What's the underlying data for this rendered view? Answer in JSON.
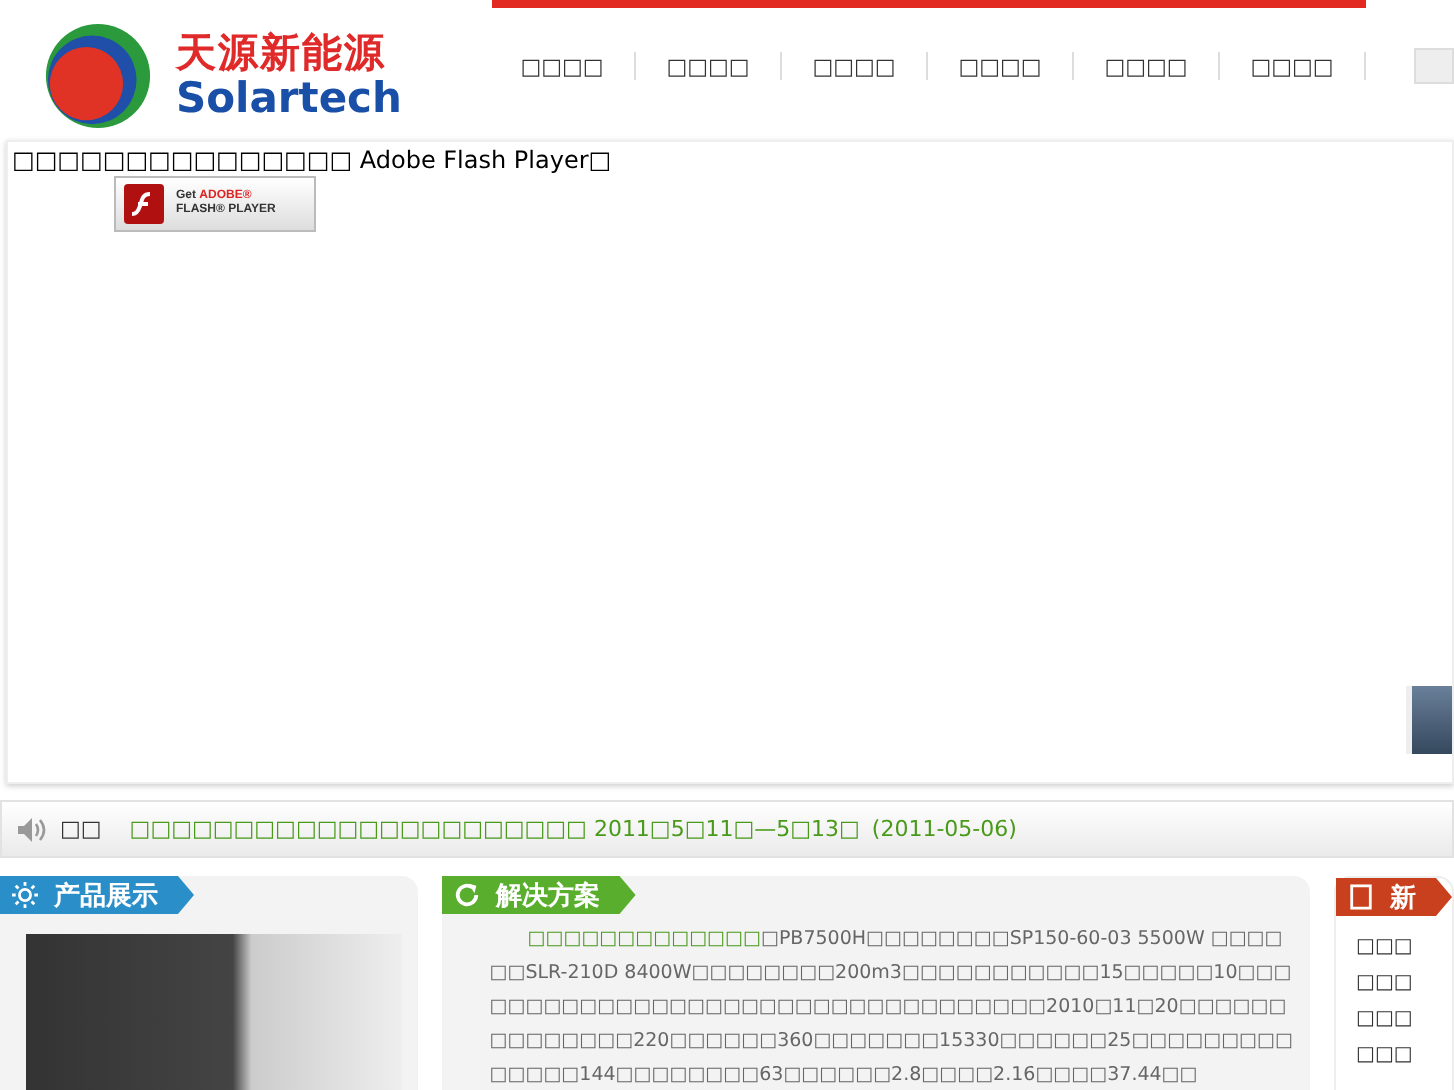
{
  "logo": {
    "cn": "天源新能源",
    "en": "Solartech"
  },
  "nav": [
    {
      "label": "□□□□"
    },
    {
      "label": "□□□□"
    },
    {
      "label": "□□□□"
    },
    {
      "label": "□□□□"
    },
    {
      "label": "□□□□"
    },
    {
      "label": "□□□□"
    }
  ],
  "flash": {
    "message": "□□□□□□□□□□□□□□□ Adobe Flash Player□",
    "badge_top": "Get",
    "badge_brand": "ADOBE®",
    "badge_bottom": "FLASH® PLAYER"
  },
  "notice": {
    "label": "□□",
    "link": "□□□□□□□□□□□□□□□□□□□□□□ 2011□5□11□—5□13□",
    "date": "(2011-05-06)"
  },
  "products": {
    "title": "产品展示"
  },
  "solutions": {
    "title": "解决方案",
    "lead": "□□□□□□□□□□□□□",
    "text": "□PB7500H□□□□□□□□SP150-60-03 5500W □□□□□□SLR-210D 8400W□□□□□□□□200m3□□□□□□□□□□□15□□□□□10□□□□□□□□□□□□□□□□□□□□□□□□□□□□□□□□□□2010□11□20□□□□□□□□□□□□□□220□□□□□□360□□□□□□□15330□□□□□□25□□□□□□□□□□□□□□144□□□□□□□□63□□□□□□2.8□□□□2.16□□□□37.44□□"
  },
  "news": {
    "title": "新",
    "items": [
      "□□□",
      "□□□",
      "□□□",
      "□□□"
    ]
  }
}
